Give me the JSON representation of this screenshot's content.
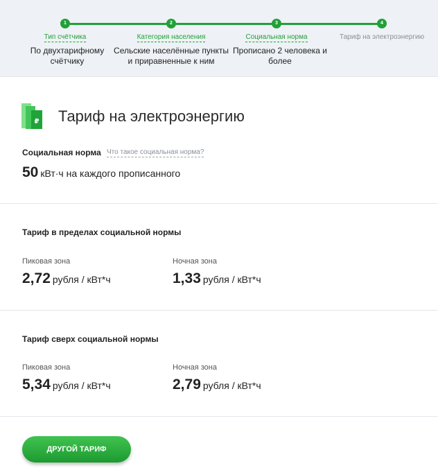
{
  "stepper": {
    "steps": [
      {
        "number": "1",
        "title": "Тип счётчика",
        "value": "По двухтарифному счётчику"
      },
      {
        "number": "2",
        "title": "Категория населения",
        "value": "Сельские населённые пункты и приравненные к ним"
      },
      {
        "number": "3",
        "title": "Социальная норма",
        "value": "Прописано 2 человека и более"
      },
      {
        "number": "4",
        "title": "Тариф на электроэнергию",
        "value": ""
      }
    ]
  },
  "main": {
    "title": "Тариф на электроэнергию",
    "social_norm": {
      "label": "Социальная норма",
      "help_link": "Что такое социальная норма?",
      "value": "50",
      "unit": "кВт·ч на каждого прописанного"
    },
    "within_norm": {
      "heading": "Тариф в пределах социальной нормы",
      "peak": {
        "label": "Пиковая зона",
        "value": "2,72",
        "unit": "рубля / кВт*ч"
      },
      "night": {
        "label": "Ночная зона",
        "value": "1,33",
        "unit": "рубля / кВт*ч"
      }
    },
    "above_norm": {
      "heading": "Тариф сверх социальной нормы",
      "peak": {
        "label": "Пиковая зона",
        "value": "5,34",
        "unit": "рубля / кВт*ч"
      },
      "night": {
        "label": "Ночная зона",
        "value": "2,79",
        "unit": "рубля / кВт*ч"
      }
    },
    "other_tariff_button": "ДРУГОЙ ТАРИФ"
  },
  "colors": {
    "accent": "#21a038",
    "header_bg": "#eef1f5"
  },
  "icons": {
    "logo": "ruble-bars-icon"
  }
}
